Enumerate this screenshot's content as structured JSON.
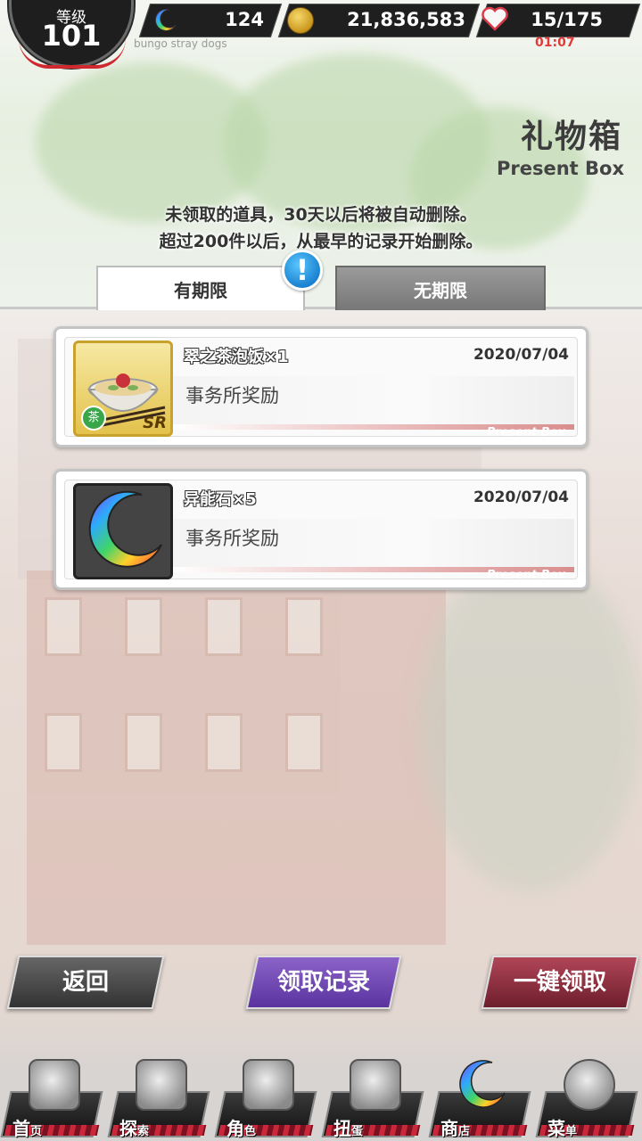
{
  "hud": {
    "level_label": "等级",
    "level_value": "101",
    "stones": "124",
    "coins": "21,836,583",
    "stamina": "15/175",
    "timer": "01:07",
    "subtitle": "bungo stray dogs"
  },
  "page": {
    "title_cn": "礼物箱",
    "title_en": "Present Box",
    "notice_line1": "未领取的道具，30天以后将被自动删除。",
    "notice_line2": "超过200件以后，从最早的记录开始删除。"
  },
  "tabs": [
    {
      "label": "有期限",
      "active": true
    },
    {
      "label": "无期限",
      "active": false
    }
  ],
  "alert_icon": "!",
  "presents": [
    {
      "name": "翠之茶泡饭×1",
      "date": "2020/07/04",
      "source": "事务所奖励",
      "tag": "Present Box",
      "rarity": "SR",
      "category": "茶",
      "icon": "rice-bowl-icon"
    },
    {
      "name": "异能石×5",
      "date": "2020/07/04",
      "source": "事务所奖励",
      "tag": "Present Box",
      "icon": "ability-stone-icon"
    }
  ],
  "actions": {
    "back": "返回",
    "history": "领取记录",
    "claim_all": "一键领取"
  },
  "nav": [
    {
      "main": "首",
      "small": "页",
      "icon": "home-icon"
    },
    {
      "main": "探",
      "small": "索",
      "icon": "explore-icon"
    },
    {
      "main": "角",
      "small": "色",
      "icon": "characters-icon"
    },
    {
      "main": "扭",
      "small": "蛋",
      "icon": "gacha-icon"
    },
    {
      "main": "商",
      "small": "店",
      "icon": "shop-icon"
    },
    {
      "main": "菜",
      "small": "单",
      "icon": "menu-gear-icon"
    }
  ],
  "colors": {
    "accent_red": "#d0282f",
    "history_purple": "#6e44b4",
    "claim_red": "#8e2a3a",
    "alert_blue": "#1a82d0"
  }
}
